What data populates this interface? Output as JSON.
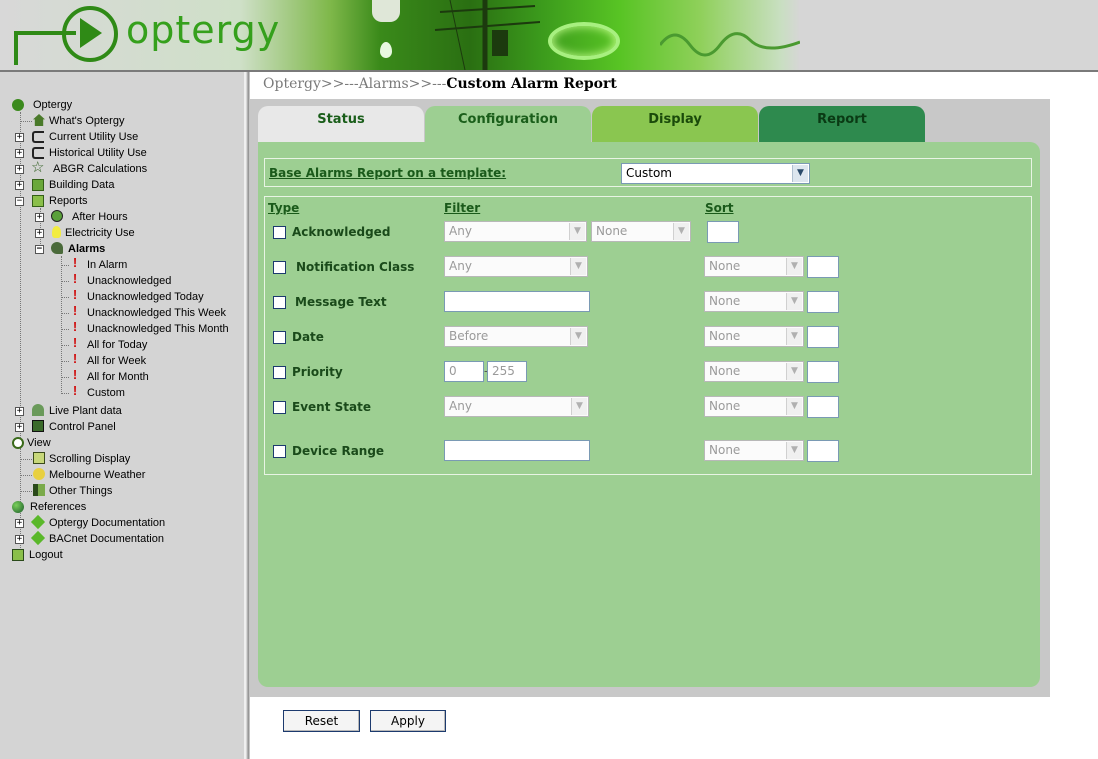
{
  "header": {
    "logo_text": "optergy"
  },
  "breadcrumb": {
    "part1": "Optergy>>---Alarms>>---",
    "current": "Custom Alarm Report"
  },
  "tabs": [
    {
      "label": "Status"
    },
    {
      "label": "Configuration"
    },
    {
      "label": "Display"
    },
    {
      "label": "Report"
    }
  ],
  "template": {
    "label": "Base Alarms Report on a template:",
    "value": "Custom"
  },
  "columns": {
    "type": "Type",
    "filter": "Filter",
    "sort": "Sort"
  },
  "rows": {
    "acknowledged": {
      "label": "Acknowledged",
      "filter1": "Any",
      "filter2": "None"
    },
    "notification_class": {
      "label": "Notification Class",
      "filter": "Any",
      "sort": "None"
    },
    "message_text": {
      "label": "Message Text",
      "sort": "None"
    },
    "date": {
      "label": "Date",
      "filter": "Before",
      "sort": "None"
    },
    "priority": {
      "label": "Priority",
      "min": "0",
      "sep": "-",
      "max": "255",
      "sort": "None"
    },
    "event_state": {
      "label": "Event State",
      "filter": "Any",
      "sort": "None"
    },
    "device_range": {
      "label": "Device Range",
      "sort": "None"
    }
  },
  "buttons": {
    "reset": "Reset",
    "apply": "Apply"
  },
  "tree": [
    {
      "label": "Optergy"
    },
    {
      "label": "What's Optergy"
    },
    {
      "label": "Current Utility Use"
    },
    {
      "label": "Historical Utility Use"
    },
    {
      "label": "ABGR Calculations"
    },
    {
      "label": "Building Data"
    },
    {
      "label": "Reports"
    },
    {
      "label": "After Hours"
    },
    {
      "label": "Electricity Use"
    },
    {
      "label": "Alarms"
    },
    {
      "label": "In Alarm"
    },
    {
      "label": "Unacknowledged"
    },
    {
      "label": "Unacknowledged Today"
    },
    {
      "label": "Unacknowledged This Week"
    },
    {
      "label": "Unacknowledged This Month"
    },
    {
      "label": "All for Today"
    },
    {
      "label": "All for Week"
    },
    {
      "label": "All for Month"
    },
    {
      "label": "Custom"
    },
    {
      "label": "Live Plant data"
    },
    {
      "label": "Control Panel"
    },
    {
      "label": "View"
    },
    {
      "label": "Scrolling Display"
    },
    {
      "label": "Melbourne Weather"
    },
    {
      "label": "Other Things"
    },
    {
      "label": "References"
    },
    {
      "label": "Optergy Documentation"
    },
    {
      "label": "BACnet Documentation"
    },
    {
      "label": "Logout"
    }
  ]
}
